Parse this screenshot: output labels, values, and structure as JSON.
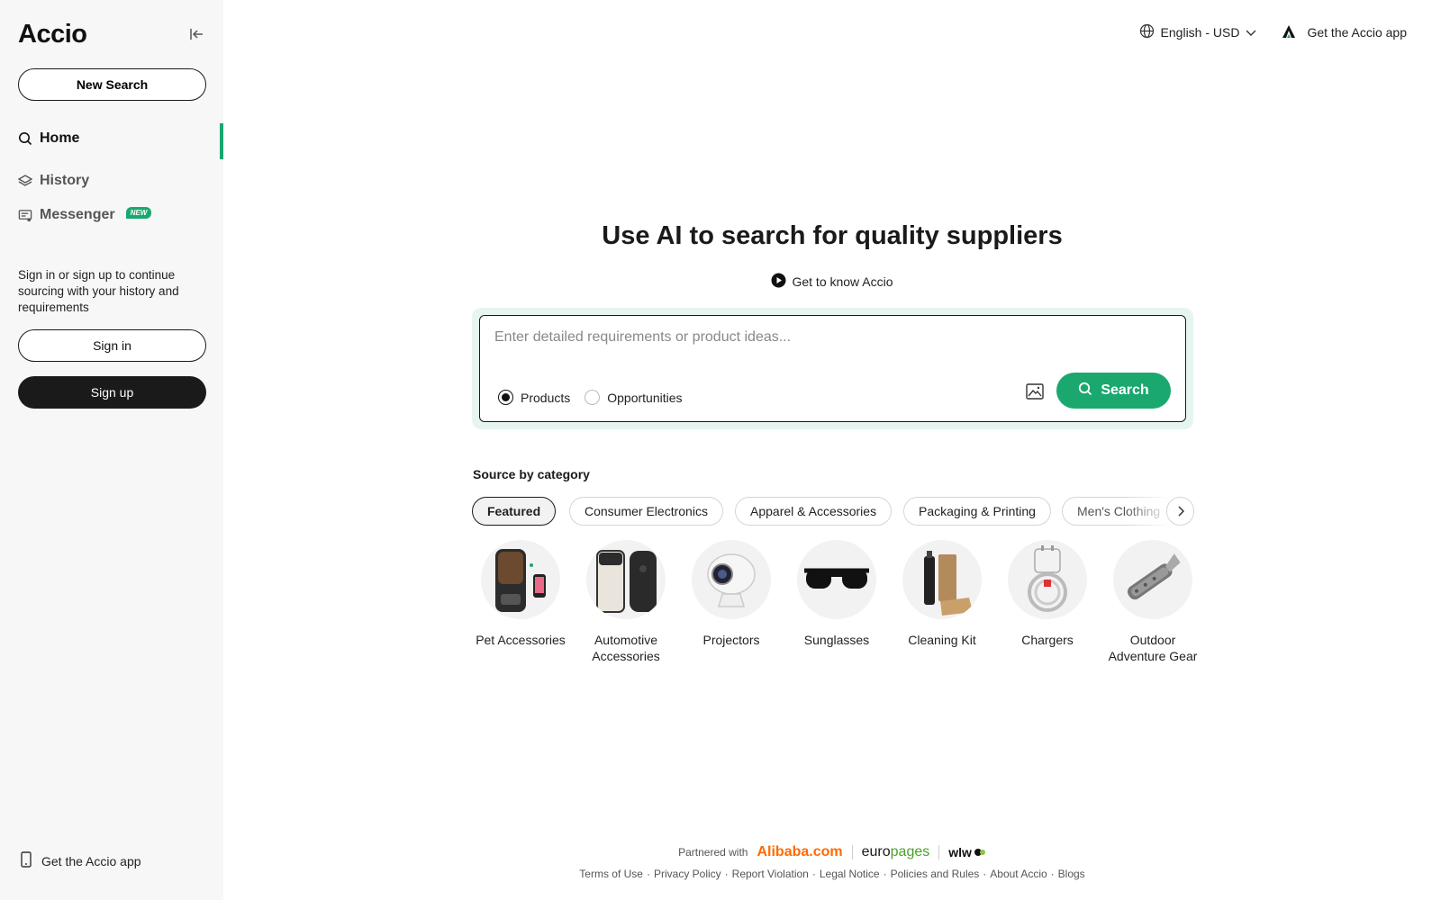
{
  "sidebar": {
    "logo": "Accio",
    "new_search": "New Search",
    "nav": [
      {
        "label": "Home",
        "icon": "search-icon"
      },
      {
        "label": "History",
        "icon": "layers-icon"
      },
      {
        "label": "Messenger",
        "icon": "chat-icon",
        "badge": "NEW"
      }
    ],
    "signin_prompt": "Sign in or sign up to continue sourcing with your history and requirements",
    "signin": "Sign in",
    "signup": "Sign up",
    "get_app": "Get the Accio app"
  },
  "topbar": {
    "language": "English - USD",
    "get_app": "Get the Accio app"
  },
  "hero": {
    "title": "Use AI to search for quality suppliers",
    "know": "Get to know Accio"
  },
  "search": {
    "placeholder": "Enter detailed requirements or product ideas...",
    "mode_products": "Products",
    "mode_opportunities": "Opportunities",
    "selected_mode": "Products",
    "button": "Search"
  },
  "categories": {
    "title": "Source by category",
    "chips": [
      "Featured",
      "Consumer Electronics",
      "Apparel & Accessories",
      "Packaging & Printing",
      "Men's Clothing"
    ],
    "active_chip": "Featured",
    "items": [
      {
        "label": "Pet Accessories",
        "icon": "pet-feeder-icon"
      },
      {
        "label": "Automotive Accessories",
        "icon": "car-accessory-icon"
      },
      {
        "label": "Projectors",
        "icon": "projector-icon"
      },
      {
        "label": "Sunglasses",
        "icon": "sunglasses-icon"
      },
      {
        "label": "Cleaning Kit",
        "icon": "cleaning-kit-icon"
      },
      {
        "label": "Chargers",
        "icon": "charger-icon"
      },
      {
        "label": "Outdoor Adventure Gear",
        "icon": "multitool-icon"
      }
    ]
  },
  "footer": {
    "partnered_with": "Partnered with",
    "partner_alibaba": "Alibaba.com",
    "partner_europages_a": "euro",
    "partner_europages_b": "pages",
    "partner_wlw": "wlw",
    "links": [
      "Terms of Use",
      "Privacy Policy",
      "Report Violation",
      "Legal Notice",
      "Policies and Rules",
      "About Accio",
      "Blogs"
    ]
  },
  "colors": {
    "accent": "#1aa86e",
    "dark": "#1a1a1a",
    "sidebar_bg": "#f7f7f7",
    "search_glow": "#e6f6ee",
    "alibaba": "#ff6a00"
  }
}
